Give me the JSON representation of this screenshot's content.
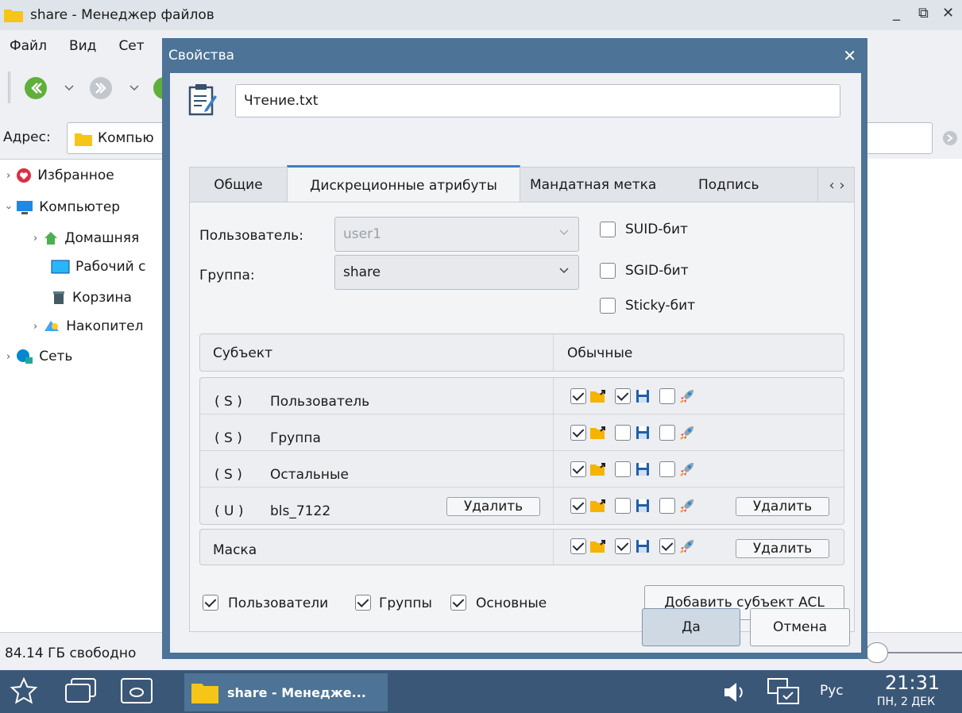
{
  "fm": {
    "title": "share - Менеджер файлов",
    "menu": [
      "Файл",
      "Вид",
      "Сет"
    ],
    "address_label": "Адрес:",
    "address_value": "Компью",
    "tree": [
      {
        "label": "Избранное"
      },
      {
        "label": "Компьютер"
      },
      {
        "label": "Домашняя"
      },
      {
        "label": "Рабочий с"
      },
      {
        "label": "Корзина"
      },
      {
        "label": "Накопител"
      },
      {
        "label": "Сеть"
      }
    ],
    "status_text": "84.14 ГБ свободно"
  },
  "dialog": {
    "title": "Свойства",
    "filename": "Чтение.txt",
    "tabs": [
      "Общие",
      "Дискреционные атрибуты",
      "Мандатная метка",
      "Подпись"
    ],
    "tab_scroll": "‹ ›",
    "user_label": "Пользователь:",
    "user_value": "user1",
    "group_label": "Группа:",
    "group_value": "share",
    "suid": {
      "label": "SUID-бит",
      "checked": false
    },
    "sgid": {
      "label": "SGID-бит",
      "checked": false
    },
    "sticky": {
      "label": "Sticky-бит",
      "checked": false
    },
    "table_header": {
      "subject": "Субъект",
      "perms": "Обычные"
    },
    "rows": [
      {
        "tag": "( S )",
        "name": "Пользователь",
        "perms": [
          true,
          true,
          false
        ],
        "delete_left": "",
        "delete_right": ""
      },
      {
        "tag": "( S )",
        "name": "Группа",
        "perms": [
          true,
          false,
          false
        ],
        "delete_left": "",
        "delete_right": ""
      },
      {
        "tag": "( S )",
        "name": "Остальные",
        "perms": [
          true,
          false,
          false
        ],
        "delete_left": "",
        "delete_right": ""
      },
      {
        "tag": "( U )",
        "name": "bls_7122",
        "perms": [
          true,
          false,
          false
        ],
        "delete_left": "Удалить",
        "delete_right": "Удалить"
      }
    ],
    "mask": {
      "name": "Маска",
      "perms": [
        true,
        true,
        true
      ],
      "delete_label": "Удалить"
    },
    "filters": [
      {
        "label": "Пользователи",
        "checked": true
      },
      {
        "label": "Группы",
        "checked": true
      },
      {
        "label": "Основные",
        "checked": true
      }
    ],
    "add_acl": "Добавить субъект ACL",
    "ok": "Да",
    "cancel": "Отмена"
  },
  "taskbar": {
    "task_label": "share - Менедже...",
    "lang": "Рус",
    "time": "21:31",
    "date": "ПН, 2 ДЕК"
  },
  "colors": {
    "dialog_frame": "#4d7396",
    "taskbar": "#3b5777",
    "tab_accent": "#3d7fc5"
  }
}
